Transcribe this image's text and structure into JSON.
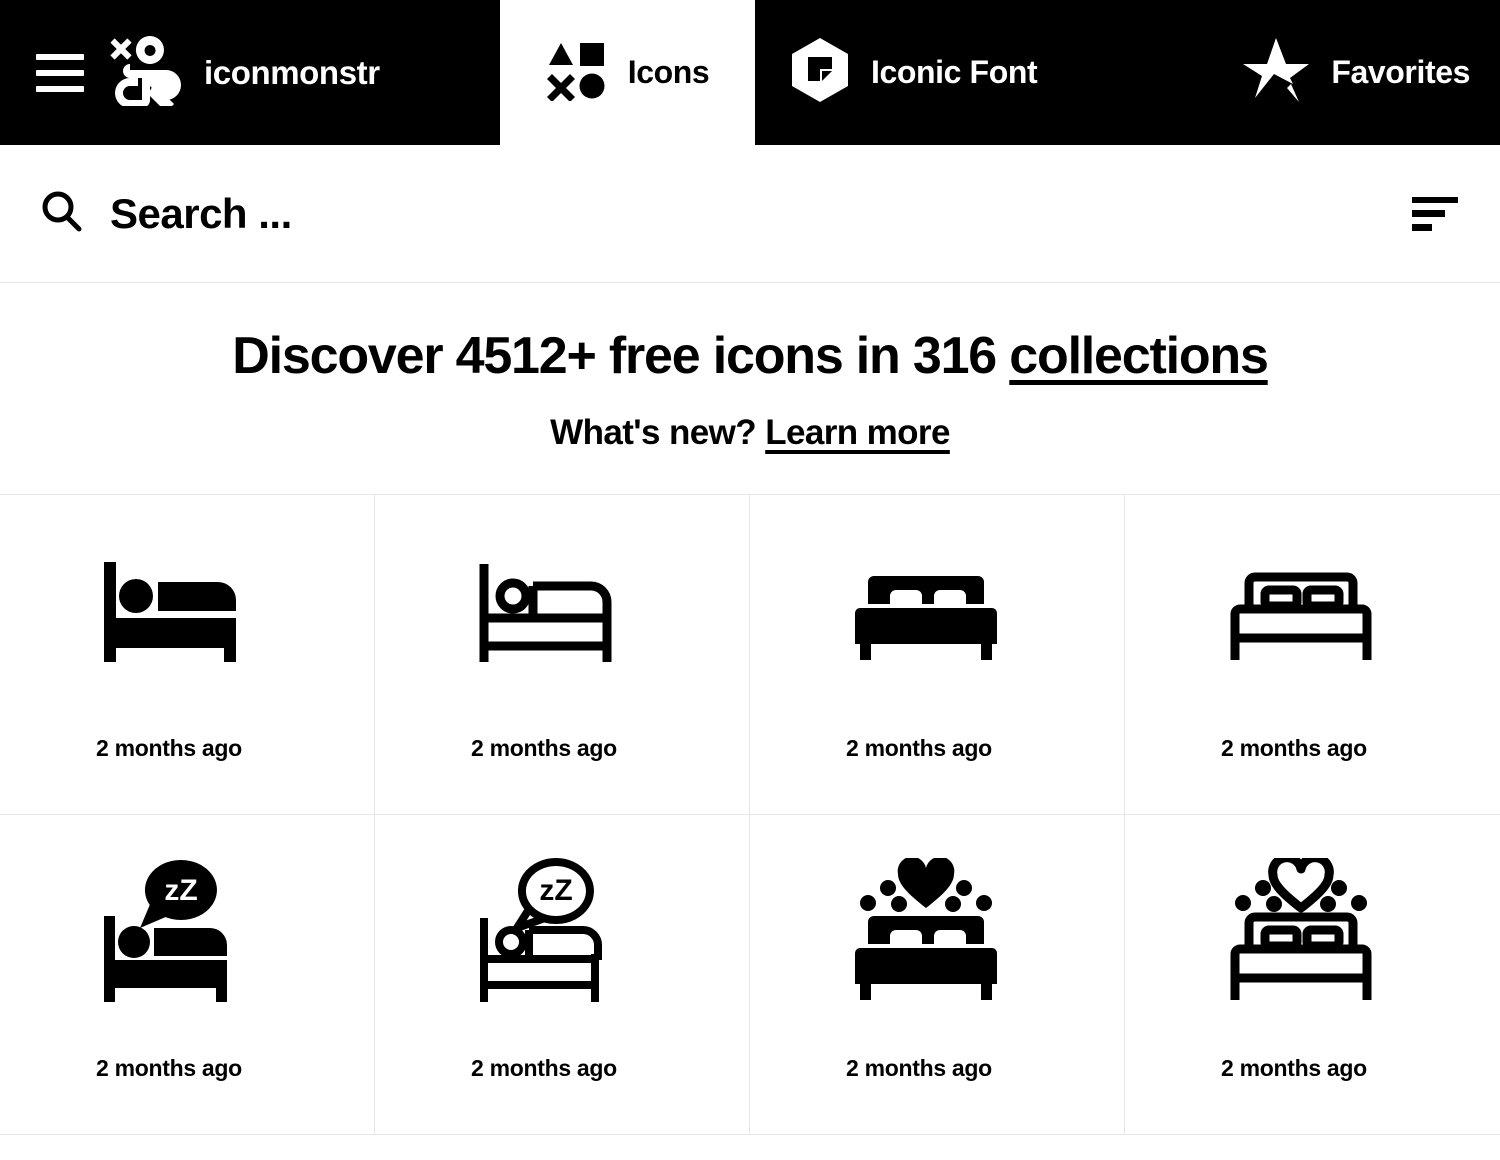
{
  "header": {
    "menu_icon": "hamburger-menu-icon",
    "brand": {
      "logo_icon": "iconmonstr-logo-icon",
      "name": "iconmonstr"
    },
    "tabs": [
      {
        "id": "icons",
        "label": "Icons",
        "icon": "shapes-grid-icon",
        "active": true
      },
      {
        "id": "iconic-font",
        "label": "Iconic Font",
        "icon": "hexagon-f-icon",
        "active": false
      },
      {
        "id": "favorites",
        "label": "Favorites",
        "icon": "star-icon",
        "active": false
      }
    ]
  },
  "search": {
    "placeholder": "Search ...",
    "value": "",
    "search_icon": "search-icon",
    "sort_icon": "sort-filter-icon"
  },
  "hero": {
    "title_prefix": "Discover 4512+ free icons in 316 ",
    "title_link": "collections",
    "icon_count": "4512+",
    "collection_count": "316",
    "subtitle_prefix": "What's new? ",
    "subtitle_link": "Learn more"
  },
  "grid": {
    "items": [
      {
        "icon": "bed-single-side-filled-icon",
        "caption": "2 months ago"
      },
      {
        "icon": "bed-single-side-outline-icon",
        "caption": "2 months ago"
      },
      {
        "icon": "bed-double-front-filled-icon",
        "caption": "2 months ago"
      },
      {
        "icon": "bed-double-front-outline-icon",
        "caption": "2 months ago"
      },
      {
        "icon": "bed-sleep-zz-filled-icon",
        "caption": "2 months ago"
      },
      {
        "icon": "bed-sleep-zz-outline-icon",
        "caption": "2 months ago"
      },
      {
        "icon": "bed-love-heart-filled-icon",
        "caption": "2 months ago"
      },
      {
        "icon": "bed-love-heart-outline-icon",
        "caption": "2 months ago"
      }
    ]
  },
  "colors": {
    "nav_background": "#000000",
    "page_background": "#ffffff",
    "text": "#000000",
    "nav_text": "#ffffff",
    "grid_line": "#e6e6e6"
  }
}
